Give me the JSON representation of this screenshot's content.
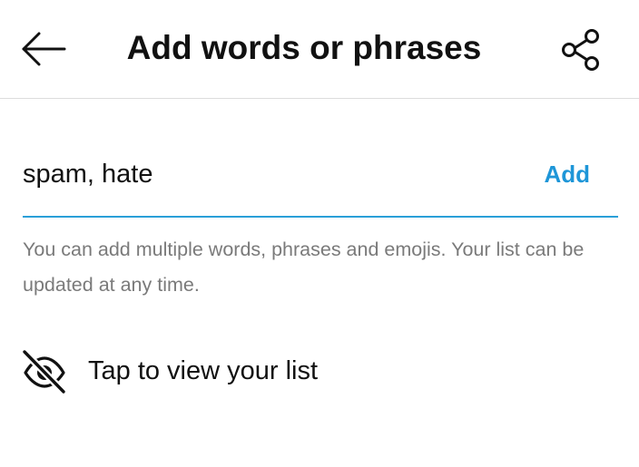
{
  "header": {
    "back_icon": "arrow-left-icon",
    "title": "Add words or phrases",
    "share_icon": "share-icon"
  },
  "input": {
    "value": "spam, hate",
    "placeholder": "",
    "add_label": "Add",
    "accent_color": "#1e96d8"
  },
  "helper_text": "You can add multiple words, phrases and emojis. Your list can be updated at any time.",
  "view_list": {
    "icon": "eye-off-icon",
    "label": "Tap to view your list"
  }
}
